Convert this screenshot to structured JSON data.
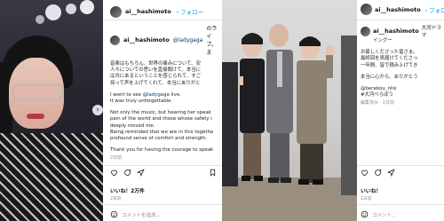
{
  "post1": {
    "username": "ai__hashimoto",
    "follow": "・フォロー",
    "caption_mention": "@ladygaga",
    "caption_after_mention": "のライブ。ま",
    "caption_jp": [
      "音楽はもちろん、世界の痛みについて、安",
      "人々についての思いを直接聞けて、本当に",
      "は共にあるということを感じられて、すご",
      "持って声を上げてくれて、本当にありがと"
    ],
    "caption_en_1": "I went to see",
    "caption_en_1_mention": "@ladygaga",
    "caption_en_1_end": "live.",
    "caption_en_2": "It was truly unforgettable.",
    "caption_en_3": [
      "Not only the music, but hearing her speak",
      "pain of the world and those whose safety i",
      "deeply moved me.",
      "Being reminded that we are in this togethe",
      "profound sense of comfort and strength."
    ],
    "caption_en_4": "Thank you for having the courage to speak",
    "caption_meta": "2日前",
    "likes": "いいね！2万件",
    "date": "2日前",
    "comment_placeholder": "コメントを追加..."
  },
  "post2": {
    "username": "ai__hashimoto",
    "follow": "・フォロー",
    "caption_top": "大河ドラマ",
    "caption_top2": "イングー",
    "caption_lines": [
      "お疲しくださった皆さま。",
      "最終回を見届けてくださっ",
      "一年間、皆で積み上げてき"
    ],
    "caption_thanks": "本当に心から、ありがとう",
    "tag1": "@berabou_nhk",
    "tag2": "#大河べらぼう",
    "meta": "編集済み · 1日前",
    "likes": "いいね！",
    "date": "1日前",
    "comment_placeholder": "コメント..."
  },
  "icons": [
    "heart-icon",
    "comment-icon",
    "share-icon",
    "bookmark-icon",
    "emoji-icon"
  ],
  "colors": {
    "link": "#00376b",
    "follow": "#0095f6",
    "muted": "#8e8e8e"
  }
}
